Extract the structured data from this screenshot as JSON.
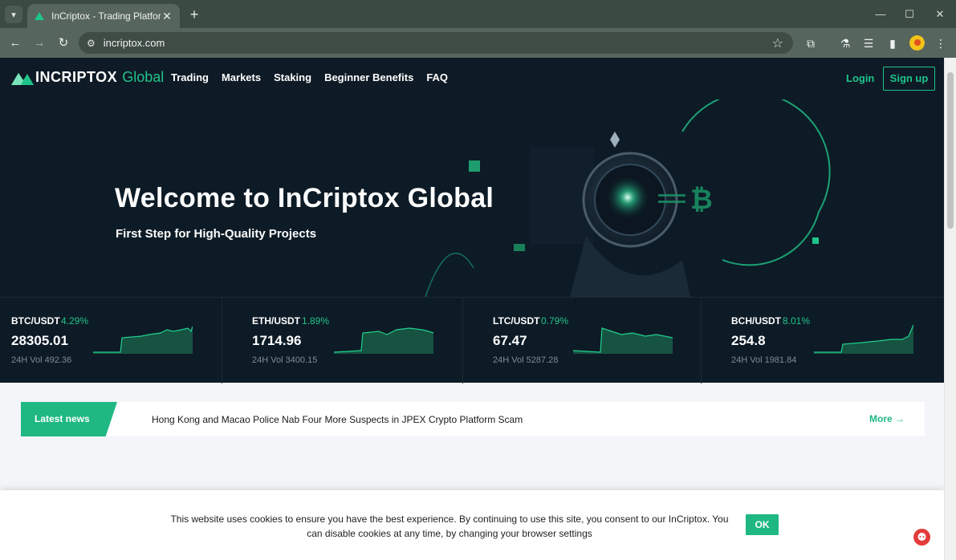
{
  "browser": {
    "tab_title": "InCriptox - Trading Platform",
    "tab_close": "✕",
    "new_tab": "+",
    "url": "incriptox.com",
    "win_minimize": "—",
    "win_maximize": "☐",
    "win_close": "✕"
  },
  "header": {
    "logo_text": "INCRIPTOX",
    "logo_sub": "Global",
    "nav": [
      "Trading",
      "Markets",
      "Staking",
      "Beginner Benefits",
      "FAQ"
    ],
    "login": "Login",
    "signup": "Sign up"
  },
  "hero": {
    "title": "Welcome to InCriptox Global",
    "subtitle": "First Step for High-Quality Projects"
  },
  "tickers": [
    {
      "pair": "BTC/USDT",
      "change": "4.29%",
      "price": "28305.01",
      "volume": "24H Vol 492.36"
    },
    {
      "pair": "ETH/USDT",
      "change": "1.89%",
      "price": "1714.96",
      "volume": "24H Vol 3400.15"
    },
    {
      "pair": "LTC/USDT",
      "change": "0.79%",
      "price": "67.47",
      "volume": "24H Vol 5287.28"
    },
    {
      "pair": "BCH/USDT",
      "change": "8.01%",
      "price": "254.8",
      "volume": "24H Vol 1981.84"
    }
  ],
  "news": {
    "label": "Latest news",
    "headline": "Hong Kong and Macao Police Nab Four More Suspects in JPEX Crypto Platform Scam",
    "more": "More →"
  },
  "cookie": {
    "text": "This website uses cookies to ensure you have the best experience. By continuing to use this site, you consent to our InCriptox. You can disable cookies at any time, by changing your browser settings",
    "ok": "OK"
  },
  "colors": {
    "accent": "#1fb882",
    "dark_bg": "#0d1b26",
    "chrome": "#56655e"
  }
}
